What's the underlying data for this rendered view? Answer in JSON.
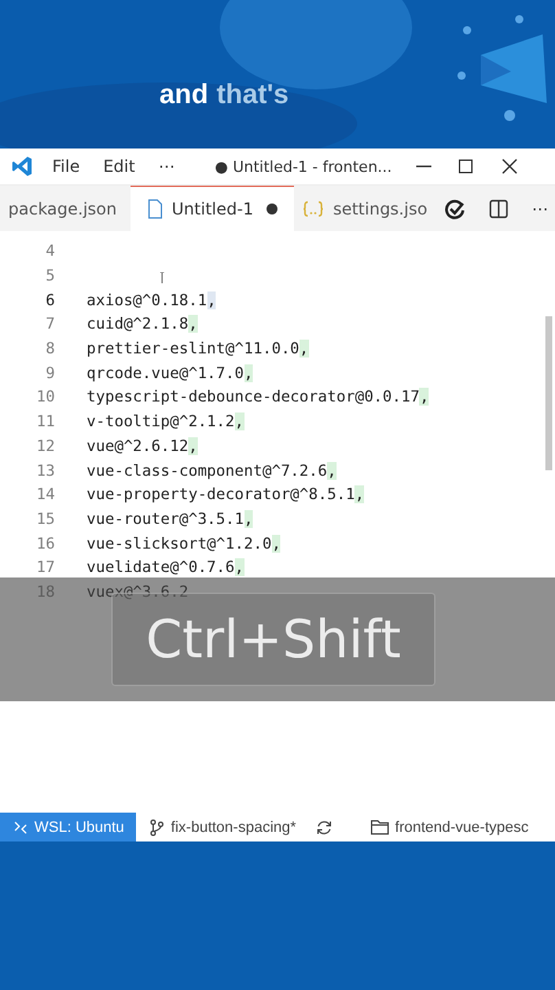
{
  "caption": {
    "words": [
      {
        "text": "and",
        "emphasis": true
      },
      {
        "text": "that's",
        "emphasis": false
      }
    ]
  },
  "title_bar": {
    "menu": [
      "File",
      "Edit",
      "⋯"
    ],
    "title": "● Untitled-1 - fronten..."
  },
  "tabs": [
    {
      "label": "package.json",
      "kind": "plain",
      "selected": false,
      "dirty": false
    },
    {
      "label": "Untitled-1",
      "kind": "file",
      "selected": true,
      "dirty": true
    },
    {
      "label": "settings.jso",
      "kind": "json",
      "selected": false,
      "dirty": false
    }
  ],
  "tab_more": "⋯",
  "editor": {
    "lines": [
      {
        "number": "4",
        "current": false
      },
      {
        "number": "5",
        "current": false
      },
      {
        "number": "6",
        "text": "axios@^0.18.1",
        "suffix": ",",
        "current": true
      },
      {
        "number": "7",
        "text": "cuid@^2.1.8",
        "suffix": ",",
        "current": false
      },
      {
        "number": "8",
        "text": "prettier-eslint@^11.0.0",
        "suffix": ",",
        "current": false
      },
      {
        "number": "9",
        "text": "qrcode.vue@^1.7.0",
        "suffix": ",",
        "current": false
      },
      {
        "number": "10",
        "text": "typescript-debounce-decorator@0.0.17",
        "suffix": ",",
        "current": false
      },
      {
        "number": "11",
        "text": "v-tooltip@^2.1.2",
        "suffix": ",",
        "current": false
      },
      {
        "number": "12",
        "text": "vue@^2.6.12",
        "suffix": ",",
        "current": false
      },
      {
        "number": "13",
        "text": "vue-class-component@^7.2.6",
        "suffix": ",",
        "current": false
      },
      {
        "number": "14",
        "text": "vue-property-decorator@^8.5.1",
        "suffix": ",",
        "current": false
      },
      {
        "number": "15",
        "text": "vue-router@^3.5.1",
        "suffix": ",",
        "current": false
      },
      {
        "number": "16",
        "text": "vue-slicksort@^1.2.0",
        "suffix": ",",
        "current": false
      },
      {
        "number": "17",
        "text": "vuelidate@^0.7.6",
        "suffix": ",",
        "current": false
      },
      {
        "number": "18",
        "text": "vuex@^3.6.2",
        "current": false
      }
    ]
  },
  "key_overlay": {
    "keys": "Ctrl+Shift"
  },
  "status_bar": {
    "remote": "WSL: Ubuntu",
    "branch": "fix-button-spacing*",
    "folder": "frontend-vue-typesc"
  }
}
